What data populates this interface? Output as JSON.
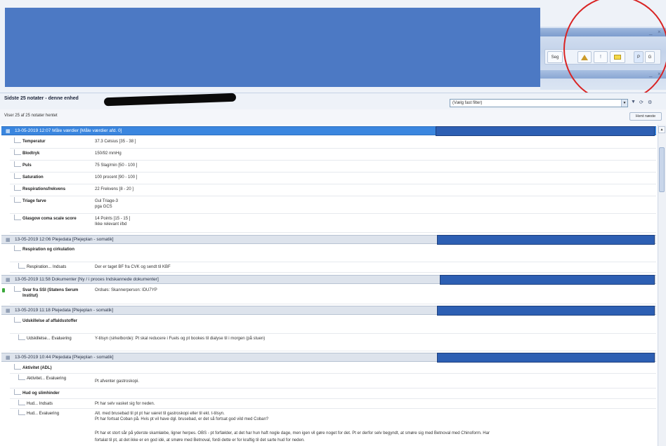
{
  "window": {
    "toolbar": {
      "seg_label": "Seg",
      "p_label": "P",
      "g_label": "G",
      "min_glyph": "_",
      "close_glyph": "×"
    }
  },
  "header": {
    "title": "Sidste 25 notater - denne enhed",
    "filter_placeholder": "(Vælg fast filter)",
    "count_text": "Viser 25 af 25 notater hentet",
    "fetch_button": "Hent næste",
    "icons": [
      "filter-icon",
      "refresh-icon",
      "settings-icon"
    ]
  },
  "notes": [
    {
      "header": "13-05-2019 12:07  Måle værdier [Måle værdier afd. 0]",
      "selected": true,
      "rows": [
        {
          "label": "Temperatur",
          "value": "37.3 Celsius [35 - 38 ]"
        },
        {
          "label": "Blodtryk",
          "value": "150/92 mmHg"
        },
        {
          "label": "Puls",
          "value": "75 Slag/min [50 - 100 ]"
        },
        {
          "label": "Saturation",
          "value": "100 procent [90 - 100 ]"
        },
        {
          "label": "Respirationsfrekvens",
          "value": "22 Frekvens [8 - 20 ]"
        },
        {
          "label": "Triage farve",
          "value": "Gul Triage-3",
          "value2": "pga GCS"
        },
        {
          "label": "Glasgow coma scale score",
          "value": "14 Points [15 - 15 ]",
          "value2": "Ikke relevant i/bd"
        }
      ]
    },
    {
      "header": "13-05-2019 12:06  Plejedata [Plejeplan - somatik]",
      "rows": [
        {
          "label": "Respiration og cirkulation",
          "value": ""
        },
        {
          "label": "Respiration... Indsats",
          "value": "Der er taget BF fra CVK og sendt til KBF",
          "sub": true
        }
      ]
    },
    {
      "header": "13-05-2019 11:58  Dokumenter [Ny / i proces Indskannede dokumenter]",
      "rows": [
        {
          "label": "Svar fra SSI (Statens Serum Institut)",
          "value": "Ordsøs: Skannerperson: IDU7YP",
          "green": true
        }
      ]
    },
    {
      "header": "13-05-2019 11:18  Plejedata [Plejeplan - somatik]",
      "rows": [
        {
          "label": "Udskillelse af affaldsstoffer",
          "value": ""
        },
        {
          "label": "Udskillelse... Evaluering",
          "value": "Y-tilsyn (sirkelborde): Pt skal reducere i Fuels og pt bookes til dialyse til i morgen (på stuen)",
          "sub": true
        }
      ]
    },
    {
      "header": "13-05-2019 10:44  Plejedata [Plejeplan - somatik]",
      "rows": [
        {
          "label": "Aktivitet (ADL)",
          "value": ""
        },
        {
          "label": "Aktivitet... Evaluering",
          "value": "Pt afventer gastroskopi.",
          "sub": true
        },
        {
          "label": "Hud og slimhinder",
          "value": ""
        },
        {
          "label": "Hud... Indsats",
          "value": "Pt har selv vasket sig for neden.",
          "sub": true
        },
        {
          "label": "Hud... Evaluering",
          "value": "Alt. med brusebad til pt pt har været til gastroskopi eller til ekt. t-tilsyn.",
          "value2": "Pt har fortsat Coban på. Hvis pt vil have dgl. brusebad, er det så fortsat god vild med Coban?",
          "sub": true
        }
      ],
      "trailing": [
        "Pt har et stort sår på yderste skamlæbe, ligner herpes. OBS - pt forfælder, at det har hun haft nogle dage, men igen vil gøre noget for det. Pt er derfor selv begyndt, at smøre sig med Betnoval med Chinoform. Har",
        "fortalat til pt, at det ikke er en god idé, at smøre med Betnoval, fordi dette er for kraftig til det sarte hud for neden."
      ]
    }
  ]
}
